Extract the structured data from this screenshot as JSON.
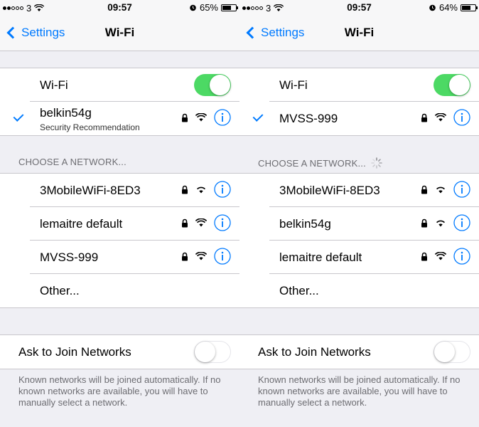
{
  "screens": [
    {
      "status": {
        "carrier": "3",
        "time": "09:57",
        "battery": "65%",
        "battery_level": 0.65
      },
      "nav": {
        "back_label": "Settings",
        "title": "Wi-Fi"
      },
      "wifi_row": {
        "label": "Wi-Fi",
        "enabled": true
      },
      "connected": {
        "name": "belkin54g",
        "subtitle": "Security Recommendation"
      },
      "section_header": "CHOOSE A NETWORK...",
      "networks": [
        {
          "name": "3MobileWiFi-8ED3"
        },
        {
          "name": "lemaitre default"
        },
        {
          "name": "MVSS-999"
        }
      ],
      "other_label": "Other...",
      "ask_to_join": {
        "label": "Ask to Join Networks",
        "enabled": false
      },
      "footer": "Known networks will be joined automatically. If no known networks are available, you will have to manually select a network."
    },
    {
      "status": {
        "carrier": "3",
        "time": "09:57",
        "battery": "64%",
        "battery_level": 0.64
      },
      "nav": {
        "back_label": "Settings",
        "title": "Wi-Fi"
      },
      "wifi_row": {
        "label": "Wi-Fi",
        "enabled": true
      },
      "connected": {
        "name": "MVSS-999",
        "subtitle": ""
      },
      "section_header": "CHOOSE A NETWORK...",
      "networks": [
        {
          "name": "3MobileWiFi-8ED3"
        },
        {
          "name": "belkin54g"
        },
        {
          "name": "lemaitre default"
        }
      ],
      "other_label": "Other...",
      "ask_to_join": {
        "label": "Ask to Join Networks",
        "enabled": false
      },
      "footer": "Known networks will be joined automatically. If no known networks are available, you will have to manually select a network."
    }
  ],
  "colors": {
    "accent": "#007aff",
    "toggle_on": "#4cd964",
    "background": "#efeff4"
  },
  "icons": [
    "chevron-left-icon",
    "checkmark-icon",
    "lock-icon",
    "wifi-icon",
    "info-icon",
    "spinner-icon",
    "alarm-icon",
    "battery-icon",
    "wifi-status-icon"
  ]
}
